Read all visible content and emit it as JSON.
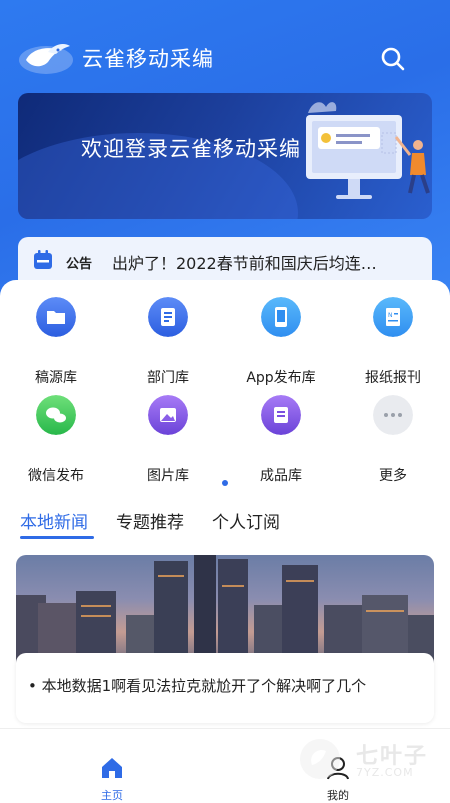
{
  "header": {
    "title": "云雀移动采编"
  },
  "banner": {
    "text": "欢迎登录云雀移动采编"
  },
  "notice": {
    "tag": "公告",
    "text": "出炉了！2022春节前和国庆后均连…"
  },
  "grid": {
    "items": [
      {
        "label": "稿源库",
        "icon": "folder-icon"
      },
      {
        "label": "部门库",
        "icon": "document-icon"
      },
      {
        "label": "App发布库",
        "icon": "phone-icon"
      },
      {
        "label": "报纸报刊",
        "icon": "newspaper-icon"
      },
      {
        "label": "微信发布",
        "icon": "wechat-icon"
      },
      {
        "label": "图片库",
        "icon": "image-icon"
      },
      {
        "label": "成品库",
        "icon": "archive-icon"
      },
      {
        "label": "更多",
        "icon": "more-icon"
      }
    ]
  },
  "tabs": [
    {
      "label": "本地新闻",
      "active": true
    },
    {
      "label": "专题推荐",
      "active": false
    },
    {
      "label": "个人订阅",
      "active": false
    }
  ],
  "news": {
    "title": "本地数据1啊看见法拉克就尬开了个解决啊了几个"
  },
  "bottom_nav": {
    "home_label": "主页",
    "mine_label": "我的"
  },
  "watermark": {
    "text": "七叶子",
    "sub": "7YZ.COM"
  },
  "colors": {
    "primary": "#2f6be6",
    "header_bg": "#2e7af0",
    "banner_bg": "#1c3f9c"
  }
}
